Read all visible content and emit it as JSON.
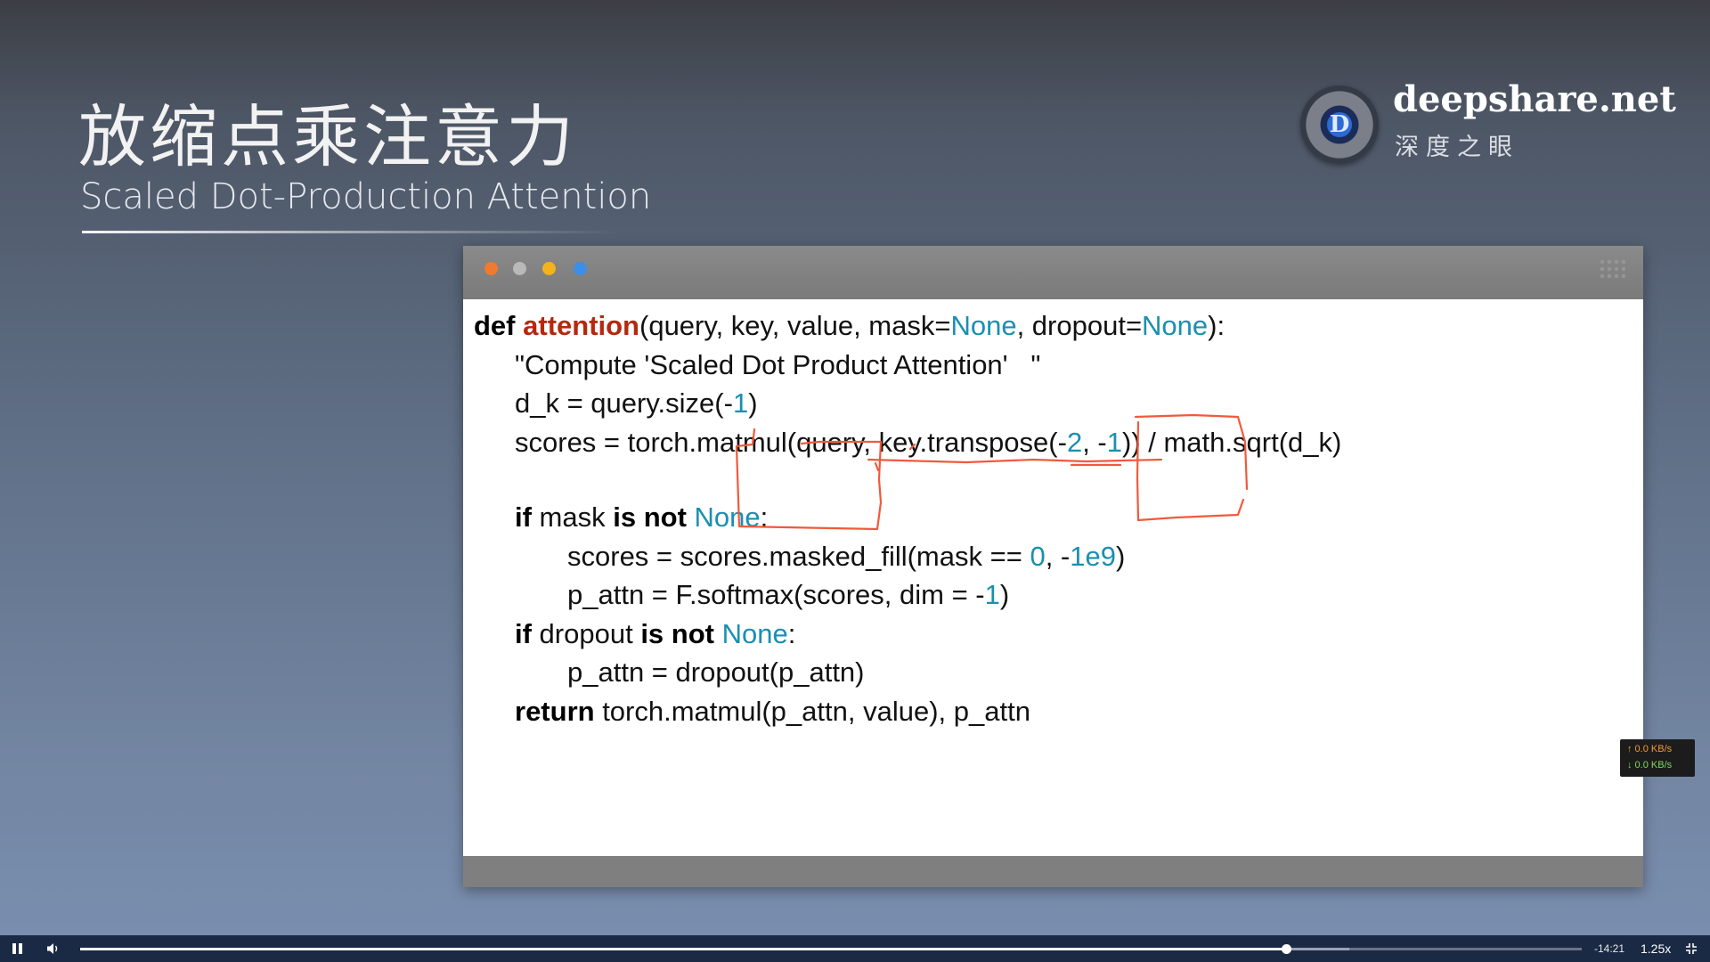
{
  "slide": {
    "title": "放缩点乘注意力",
    "subtitle": "Scaled Dot-Production Attention"
  },
  "brand": {
    "logo_letter": "D",
    "name": "deepshare.net",
    "subtitle": "深度之眼"
  },
  "code_window": {
    "dots": [
      "#f07a2d",
      "#b9b9b9",
      "#f4b21b",
      "#3d8ee8"
    ],
    "lines": [
      {
        "indent": 0,
        "tokens": [
          [
            "kw",
            "def"
          ],
          [
            "t",
            " "
          ],
          [
            "fn",
            "attention"
          ],
          [
            "t",
            "(query, key, value, mask="
          ],
          [
            "cst",
            "None"
          ],
          [
            "t",
            ", dropout="
          ],
          [
            "cst",
            "None"
          ],
          [
            "t",
            "):"
          ]
        ]
      },
      {
        "indent": 1,
        "tokens": [
          [
            "t",
            "\"Compute 'Scaled Dot Product Attention'   \""
          ]
        ]
      },
      {
        "indent": 1,
        "tokens": [
          [
            "t",
            "d_k = query.size(-"
          ],
          [
            "cst",
            "1"
          ],
          [
            "t",
            ")"
          ]
        ]
      },
      {
        "indent": 1,
        "tokens": [
          [
            "t",
            "scores = torch.matmul(query, key.transpose(-"
          ],
          [
            "cst",
            "2"
          ],
          [
            "t",
            ", -"
          ],
          [
            "cst",
            "1"
          ],
          [
            "t",
            ")) / math.sqrt(d_k)"
          ]
        ]
      },
      {
        "blank": true
      },
      {
        "indent": 1,
        "tokens": [
          [
            "kw",
            "if"
          ],
          [
            "t",
            " mask "
          ],
          [
            "kw",
            "is not"
          ],
          [
            "t",
            " "
          ],
          [
            "cst",
            "None"
          ],
          [
            "t",
            ":"
          ]
        ]
      },
      {
        "indent": 2,
        "tokens": [
          [
            "t",
            "scores = scores.masked_fill(mask == "
          ],
          [
            "cst",
            "0"
          ],
          [
            "t",
            ", -"
          ],
          [
            "cst",
            "1e9"
          ],
          [
            "t",
            ")"
          ]
        ]
      },
      {
        "indent": 2,
        "tokens": [
          [
            "t",
            "p_attn = F.softmax(scores, dim = -"
          ],
          [
            "cst",
            "1"
          ],
          [
            "t",
            ")"
          ]
        ]
      },
      {
        "indent": 1,
        "tokens": [
          [
            "kw",
            "if"
          ],
          [
            "t",
            " dropout "
          ],
          [
            "kw",
            "is not"
          ],
          [
            "t",
            " "
          ],
          [
            "cst",
            "None"
          ],
          [
            "t",
            ":"
          ]
        ]
      },
      {
        "indent": 2,
        "tokens": [
          [
            "t",
            "p_attn = dropout(p_attn)"
          ]
        ]
      },
      {
        "indent": 1,
        "tokens": [
          [
            "kw",
            "return"
          ],
          [
            "t",
            " torch.matmul(p_attn, value), p_attn"
          ]
        ]
      }
    ],
    "annotation_color": "#ef5a3c"
  },
  "net_speed": {
    "up": "↑ 0.0 KB/s",
    "down": "↓ 0.0 KB/s"
  },
  "player": {
    "progress": 0.803,
    "buffered": 0.845,
    "time_remaining": "-14:21",
    "speed": "1.25x"
  }
}
